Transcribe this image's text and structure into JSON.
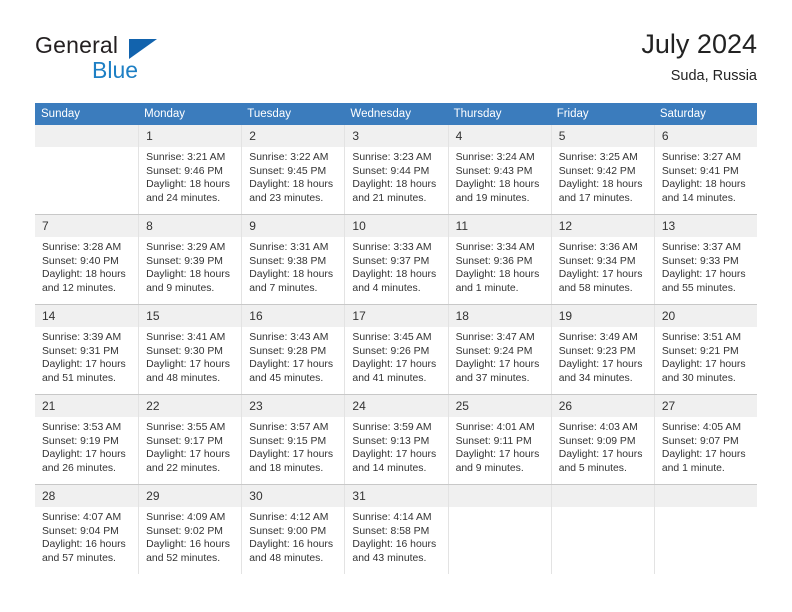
{
  "logo": {
    "word_one": "General",
    "word_two": "Blue",
    "triangle_color": "#1263ad",
    "blue_color": "#1d7fc4"
  },
  "header": {
    "title": "July 2024",
    "location": "Suda, Russia"
  },
  "theme": {
    "header_row_bg": "#3b7cbd",
    "daynum_bg": "#f0f0f0",
    "grid_line": "#c8c8c8"
  },
  "weekdays": [
    "Sunday",
    "Monday",
    "Tuesday",
    "Wednesday",
    "Thursday",
    "Friday",
    "Saturday"
  ],
  "weeks": [
    [
      {
        "day": "",
        "lines": []
      },
      {
        "day": "1",
        "lines": [
          "Sunrise: 3:21 AM",
          "Sunset: 9:46 PM",
          "Daylight: 18 hours",
          "and 24 minutes."
        ]
      },
      {
        "day": "2",
        "lines": [
          "Sunrise: 3:22 AM",
          "Sunset: 9:45 PM",
          "Daylight: 18 hours",
          "and 23 minutes."
        ]
      },
      {
        "day": "3",
        "lines": [
          "Sunrise: 3:23 AM",
          "Sunset: 9:44 PM",
          "Daylight: 18 hours",
          "and 21 minutes."
        ]
      },
      {
        "day": "4",
        "lines": [
          "Sunrise: 3:24 AM",
          "Sunset: 9:43 PM",
          "Daylight: 18 hours",
          "and 19 minutes."
        ]
      },
      {
        "day": "5",
        "lines": [
          "Sunrise: 3:25 AM",
          "Sunset: 9:42 PM",
          "Daylight: 18 hours",
          "and 17 minutes."
        ]
      },
      {
        "day": "6",
        "lines": [
          "Sunrise: 3:27 AM",
          "Sunset: 9:41 PM",
          "Daylight: 18 hours",
          "and 14 minutes."
        ]
      }
    ],
    [
      {
        "day": "7",
        "lines": [
          "Sunrise: 3:28 AM",
          "Sunset: 9:40 PM",
          "Daylight: 18 hours",
          "and 12 minutes."
        ]
      },
      {
        "day": "8",
        "lines": [
          "Sunrise: 3:29 AM",
          "Sunset: 9:39 PM",
          "Daylight: 18 hours",
          "and 9 minutes."
        ]
      },
      {
        "day": "9",
        "lines": [
          "Sunrise: 3:31 AM",
          "Sunset: 9:38 PM",
          "Daylight: 18 hours",
          "and 7 minutes."
        ]
      },
      {
        "day": "10",
        "lines": [
          "Sunrise: 3:33 AM",
          "Sunset: 9:37 PM",
          "Daylight: 18 hours",
          "and 4 minutes."
        ]
      },
      {
        "day": "11",
        "lines": [
          "Sunrise: 3:34 AM",
          "Sunset: 9:36 PM",
          "Daylight: 18 hours",
          "and 1 minute."
        ]
      },
      {
        "day": "12",
        "lines": [
          "Sunrise: 3:36 AM",
          "Sunset: 9:34 PM",
          "Daylight: 17 hours",
          "and 58 minutes."
        ]
      },
      {
        "day": "13",
        "lines": [
          "Sunrise: 3:37 AM",
          "Sunset: 9:33 PM",
          "Daylight: 17 hours",
          "and 55 minutes."
        ]
      }
    ],
    [
      {
        "day": "14",
        "lines": [
          "Sunrise: 3:39 AM",
          "Sunset: 9:31 PM",
          "Daylight: 17 hours",
          "and 51 minutes."
        ]
      },
      {
        "day": "15",
        "lines": [
          "Sunrise: 3:41 AM",
          "Sunset: 9:30 PM",
          "Daylight: 17 hours",
          "and 48 minutes."
        ]
      },
      {
        "day": "16",
        "lines": [
          "Sunrise: 3:43 AM",
          "Sunset: 9:28 PM",
          "Daylight: 17 hours",
          "and 45 minutes."
        ]
      },
      {
        "day": "17",
        "lines": [
          "Sunrise: 3:45 AM",
          "Sunset: 9:26 PM",
          "Daylight: 17 hours",
          "and 41 minutes."
        ]
      },
      {
        "day": "18",
        "lines": [
          "Sunrise: 3:47 AM",
          "Sunset: 9:24 PM",
          "Daylight: 17 hours",
          "and 37 minutes."
        ]
      },
      {
        "day": "19",
        "lines": [
          "Sunrise: 3:49 AM",
          "Sunset: 9:23 PM",
          "Daylight: 17 hours",
          "and 34 minutes."
        ]
      },
      {
        "day": "20",
        "lines": [
          "Sunrise: 3:51 AM",
          "Sunset: 9:21 PM",
          "Daylight: 17 hours",
          "and 30 minutes."
        ]
      }
    ],
    [
      {
        "day": "21",
        "lines": [
          "Sunrise: 3:53 AM",
          "Sunset: 9:19 PM",
          "Daylight: 17 hours",
          "and 26 minutes."
        ]
      },
      {
        "day": "22",
        "lines": [
          "Sunrise: 3:55 AM",
          "Sunset: 9:17 PM",
          "Daylight: 17 hours",
          "and 22 minutes."
        ]
      },
      {
        "day": "23",
        "lines": [
          "Sunrise: 3:57 AM",
          "Sunset: 9:15 PM",
          "Daylight: 17 hours",
          "and 18 minutes."
        ]
      },
      {
        "day": "24",
        "lines": [
          "Sunrise: 3:59 AM",
          "Sunset: 9:13 PM",
          "Daylight: 17 hours",
          "and 14 minutes."
        ]
      },
      {
        "day": "25",
        "lines": [
          "Sunrise: 4:01 AM",
          "Sunset: 9:11 PM",
          "Daylight: 17 hours",
          "and 9 minutes."
        ]
      },
      {
        "day": "26",
        "lines": [
          "Sunrise: 4:03 AM",
          "Sunset: 9:09 PM",
          "Daylight: 17 hours",
          "and 5 minutes."
        ]
      },
      {
        "day": "27",
        "lines": [
          "Sunrise: 4:05 AM",
          "Sunset: 9:07 PM",
          "Daylight: 17 hours",
          "and 1 minute."
        ]
      }
    ],
    [
      {
        "day": "28",
        "lines": [
          "Sunrise: 4:07 AM",
          "Sunset: 9:04 PM",
          "Daylight: 16 hours",
          "and 57 minutes."
        ]
      },
      {
        "day": "29",
        "lines": [
          "Sunrise: 4:09 AM",
          "Sunset: 9:02 PM",
          "Daylight: 16 hours",
          "and 52 minutes."
        ]
      },
      {
        "day": "30",
        "lines": [
          "Sunrise: 4:12 AM",
          "Sunset: 9:00 PM",
          "Daylight: 16 hours",
          "and 48 minutes."
        ]
      },
      {
        "day": "31",
        "lines": [
          "Sunrise: 4:14 AM",
          "Sunset: 8:58 PM",
          "Daylight: 16 hours",
          "and 43 minutes."
        ]
      },
      {
        "day": "",
        "lines": []
      },
      {
        "day": "",
        "lines": []
      },
      {
        "day": "",
        "lines": []
      }
    ]
  ]
}
